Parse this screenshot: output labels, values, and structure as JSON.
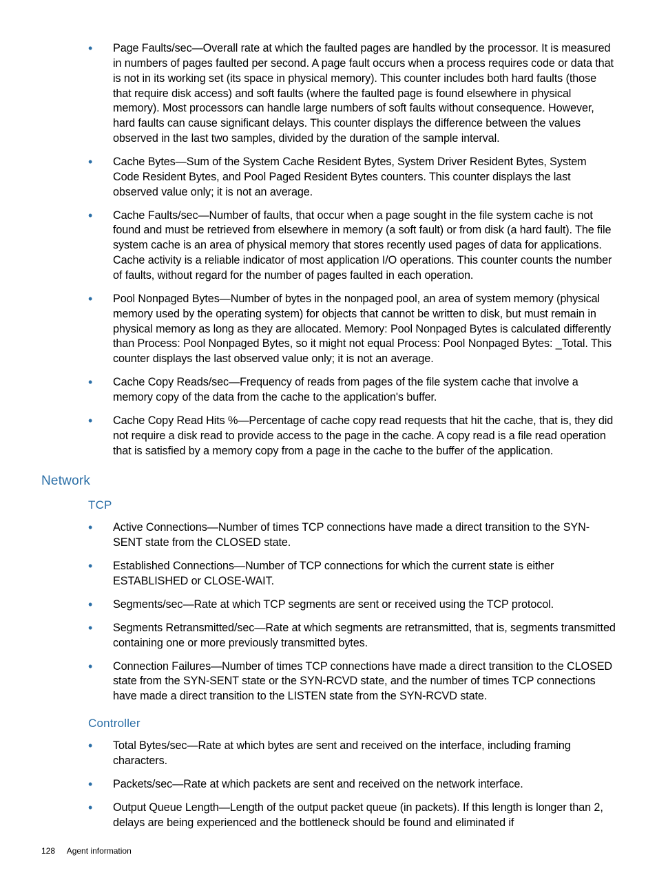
{
  "memory_items": [
    "Page Faults/sec—Overall rate at which the faulted pages are handled by the processor. It is measured in numbers of pages faulted per second. A page fault occurs when a process requires code or data that is not in its working set (its space in physical memory). This counter includes both hard faults (those that require disk access) and soft faults (where the faulted page is found elsewhere in physical memory). Most processors can handle large numbers of soft faults without consequence. However, hard faults can cause significant delays. This counter displays the difference between the values observed in the last two samples, divided by the duration of the sample interval.",
    "Cache Bytes—Sum of the System Cache Resident Bytes, System Driver Resident Bytes, System Code Resident Bytes, and Pool Paged Resident Bytes counters.  This counter displays the last observed value only; it is not an average.",
    "Cache Faults/sec—Number of faults, that occur when a page sought in the file system cache is not found and must be retrieved from elsewhere in memory (a soft fault) or from disk (a hard fault). The file system cache is an area of physical memory that stores recently used pages of data for applications. Cache activity is a reliable indicator of most application I/O operations. This counter counts the number of faults, without regard for the number of pages faulted in each operation.",
    "Pool Nonpaged Bytes—Number of bytes in the nonpaged pool, an area of system memory (physical memory used by the operating system) for objects that cannot be written to disk, but must remain in physical memory as long as they are allocated.  Memory: Pool Nonpaged Bytes is calculated differently than Process: Pool Nonpaged Bytes, so it might not equal Process: Pool Nonpaged Bytes: _Total.  This counter displays the last observed value only; it is not an average.",
    "Cache Copy Reads/sec—Frequency of reads from pages of the file system cache that involve a memory copy of the data from the cache to the application's buffer.",
    "Cache Copy Read Hits %—Percentage of cache copy read requests that hit the cache, that is, they did not require a disk read to provide access to the page in the cache. A copy read is a file read operation that is satisfied by a memory copy from a page in the cache to the buffer of the application."
  ],
  "network_heading": "Network",
  "tcp_heading": "TCP",
  "tcp_items": [
    "Active Connections—Number of times TCP connections have made a direct transition to the SYN-SENT state from the CLOSED state.",
    "Established Connections—Number of TCP connections for which the current state is either ESTABLISHED or CLOSE-WAIT.",
    "Segments/sec—Rate at which TCP segments are sent or received using the TCP protocol.",
    "Segments Retransmitted/sec—Rate at which segments are retransmitted, that is, segments transmitted containing one or more previously transmitted bytes.",
    "Connection Failures—Number of times TCP connections have made a direct transition to the CLOSED state from the SYN-SENT state or the SYN-RCVD state, and the number of times TCP connections have made a direct transition to the LISTEN state from the SYN-RCVD state."
  ],
  "controller_heading": "Controller",
  "controller_items": [
    "Total Bytes/sec—Rate at which bytes are sent and received on the interface, including framing characters.",
    "Packets/sec—Rate at which packets are sent and received on the network interface.",
    "Output Queue Length—Length of the output packet queue (in packets). If this length is longer than 2, delays are being experienced and the bottleneck should be found and eliminated if"
  ],
  "footer": {
    "page_number": "128",
    "section_label": "Agent information"
  }
}
